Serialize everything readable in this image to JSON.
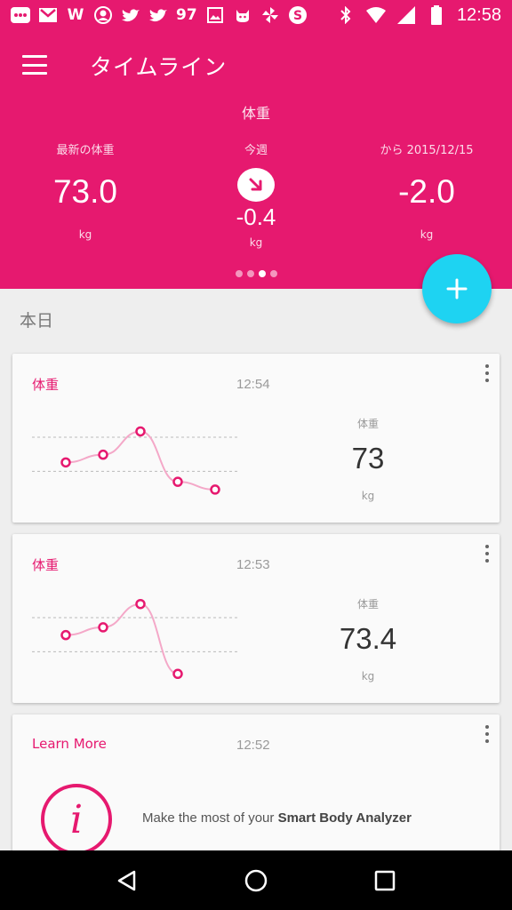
{
  "status_bar": {
    "left_icons": [
      "more-icon",
      "gmail-icon",
      "wordpress-icon",
      "avatar-icon",
      "twitter-icon",
      "twitter-icon"
    ],
    "count_text": "97",
    "right_icons": [
      "image-icon",
      "cat-icon",
      "pinwheel-icon",
      "skype-icon",
      "bluetooth-icon",
      "wifi-icon",
      "signal-icon",
      "battery-icon"
    ],
    "time": "12:58"
  },
  "header": {
    "title": "タイムライン",
    "section_title": "体重",
    "stats": [
      {
        "label": "最新の体重",
        "value": "73.0",
        "unit": "kg"
      },
      {
        "label": "今週",
        "value": "-0.4",
        "unit": "kg",
        "icon": "arrow-down-right-icon"
      },
      {
        "label": "から 2015/12/15",
        "value": "-2.0",
        "unit": "kg"
      }
    ],
    "pager": {
      "count": 4,
      "active_index": 2
    }
  },
  "fab": {
    "icon": "plus-icon"
  },
  "day_label": "本日",
  "cards": [
    {
      "title": "体重",
      "time": "12:54",
      "metric_label": "体重",
      "metric_value": "73",
      "metric_unit": "kg",
      "sparkline": [
        73.4,
        73.6,
        74.2,
        72.9,
        72.7
      ]
    },
    {
      "title": "体重",
      "time": "12:53",
      "metric_label": "体重",
      "metric_value": "73.4",
      "metric_unit": "kg",
      "sparkline": [
        73.6,
        73.8,
        74.4,
        72.6
      ]
    },
    {
      "title": "Learn More",
      "time": "12:52",
      "icon_glyph": "i",
      "text_prefix": "Make the most of your",
      "text_bold": "Smart Body Analyzer"
    }
  ],
  "colors": {
    "brand": "#e6196f",
    "fab": "#1ed3f2",
    "line": "#f4a8c8"
  },
  "nav": [
    "back-icon",
    "home-icon",
    "recents-icon"
  ]
}
